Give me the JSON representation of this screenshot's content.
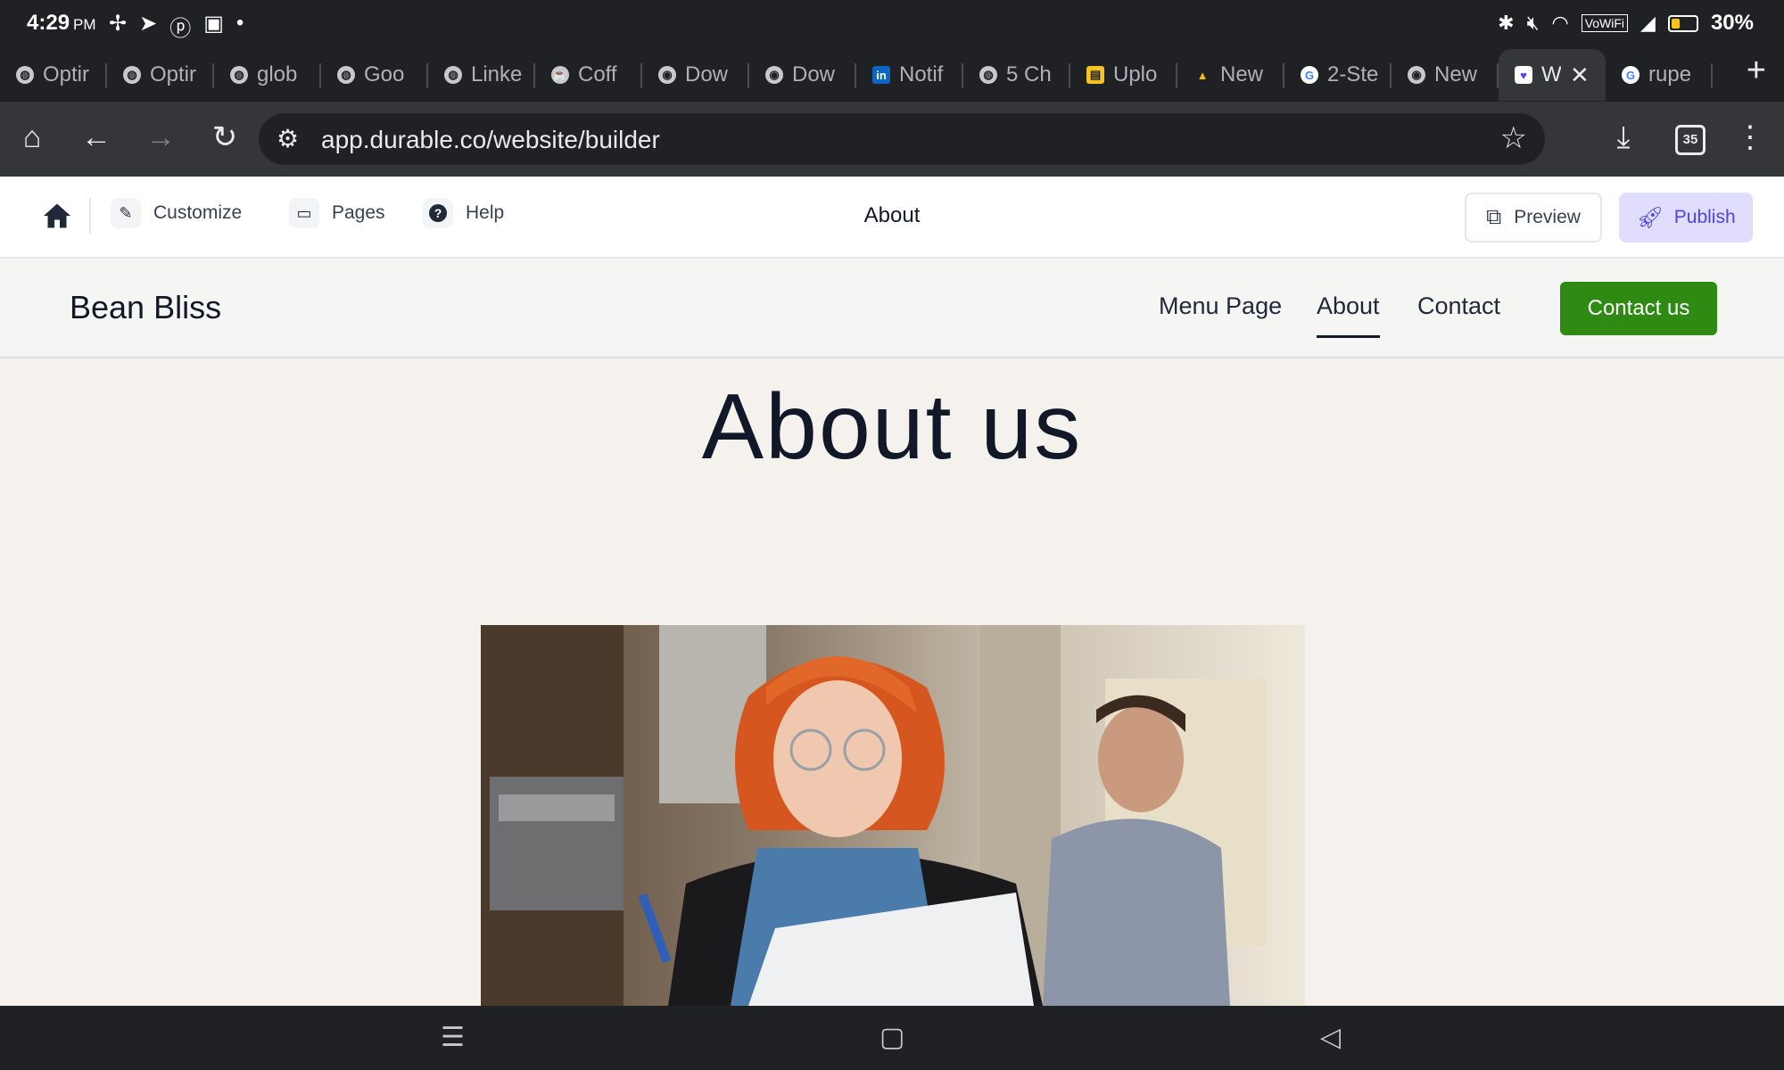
{
  "status_bar": {
    "time": "4:29",
    "ampm": "PM",
    "battery": "30%"
  },
  "tabs": [
    {
      "label": "Optir",
      "icon": "globe-icon"
    },
    {
      "label": "Optir",
      "icon": "globe-icon"
    },
    {
      "label": "glob",
      "icon": "globe-icon"
    },
    {
      "label": "Goo",
      "icon": "globe-icon"
    },
    {
      "label": "Linke",
      "icon": "globe-icon"
    },
    {
      "label": "Coff",
      "icon": "coffee-icon"
    },
    {
      "label": "Dow",
      "icon": "chrome-icon"
    },
    {
      "label": "Dow",
      "icon": "chrome-icon"
    },
    {
      "label": "Notif",
      "icon": "linkedin-icon"
    },
    {
      "label": "5 Ch",
      "icon": "globe-icon"
    },
    {
      "label": "Uplo",
      "icon": "upload-icon"
    },
    {
      "label": "New",
      "icon": "google-ads-icon"
    },
    {
      "label": "2-Ste",
      "icon": "google-icon"
    },
    {
      "label": "New",
      "icon": "chrome-icon"
    },
    {
      "label": "W",
      "icon": "durable-icon",
      "active": true
    },
    {
      "label": "rupe",
      "icon": "google-icon"
    }
  ],
  "toolbar": {
    "url": "app.durable.co/website/builder",
    "tab_count": "35"
  },
  "builder": {
    "customize": "Customize",
    "pages": "Pages",
    "help": "Help",
    "page_title": "About",
    "preview": "Preview",
    "publish": "Publish"
  },
  "site": {
    "brand": "Bean Bliss",
    "nav": [
      "Menu Page",
      "About",
      "Contact"
    ],
    "active_nav": "About",
    "cta": "Contact us",
    "hero_title": "About us"
  },
  "colors": {
    "accent_green": "#2f8a14",
    "publish_bg": "#e0ddff",
    "publish_text": "#4f46e5",
    "page_bg": "#f5f1ed"
  }
}
